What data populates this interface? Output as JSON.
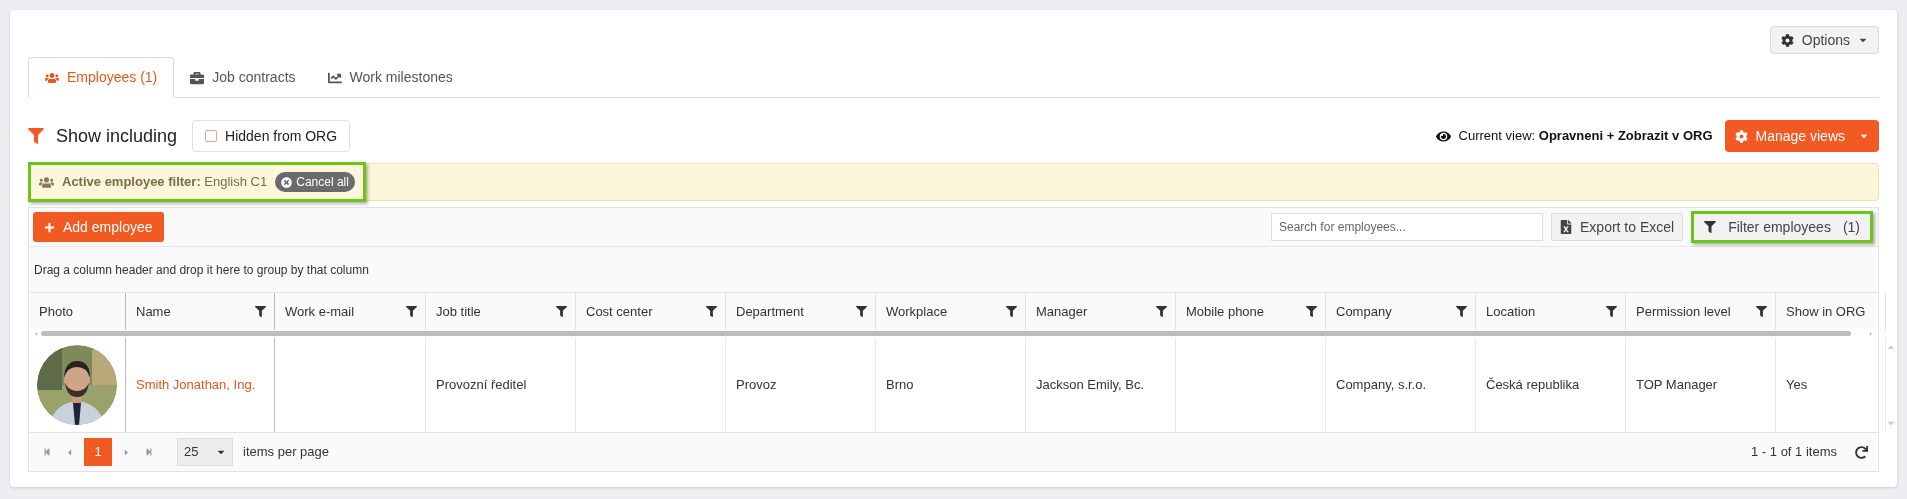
{
  "options_button": {
    "label": "Options"
  },
  "tabs": [
    {
      "label": "Employees (1)",
      "selected": true
    },
    {
      "label": "Job contracts",
      "selected": false
    },
    {
      "label": "Work milestones",
      "selected": false
    }
  ],
  "show_including": {
    "label": "Show including",
    "checkbox": {
      "label": "Hidden from ORG",
      "checked": false
    }
  },
  "current_view": {
    "label": "Current view:",
    "value": "Opravneni + Zobrazit v ORG"
  },
  "manage_views_button": {
    "label": "Manage views"
  },
  "active_filter": {
    "label": "Active employee filter:",
    "value": "English C1",
    "cancel_label": "Cancel all",
    "highlighted": true
  },
  "toolbar": {
    "add_button": "Add employee",
    "search": {
      "placeholder": "Search for employees..."
    },
    "export_button": "Export to Excel",
    "filter_button": {
      "label": "Filter employees",
      "count": "(1)",
      "highlighted": true
    }
  },
  "group_hint": "Drag a column header and drop it here to group by that column",
  "table": {
    "columns": [
      {
        "label": "Photo",
        "filterable": false
      },
      {
        "label": "Name",
        "filterable": true
      },
      {
        "label": "Work e-mail",
        "filterable": true
      },
      {
        "label": "Job title",
        "filterable": true
      },
      {
        "label": "Cost center",
        "filterable": true
      },
      {
        "label": "Department",
        "filterable": true
      },
      {
        "label": "Workplace",
        "filterable": true
      },
      {
        "label": "Manager",
        "filterable": true
      },
      {
        "label": "Mobile phone",
        "filterable": true
      },
      {
        "label": "Company",
        "filterable": true
      },
      {
        "label": "Location",
        "filterable": true
      },
      {
        "label": "Permission level",
        "filterable": true
      },
      {
        "label": "Show in ORG",
        "filterable": false
      }
    ],
    "rows": [
      {
        "cells": [
          {
            "kind": "picture"
          },
          "Smith Jonathan, Ing.",
          "",
          "Provozní ředitel",
          "",
          "Provoz",
          "Brno",
          "Jackson Emily, Bc.",
          "",
          "Company, s.r.o.",
          "Česká republika",
          "TOP Manager",
          "Yes"
        ]
      }
    ]
  },
  "pager": {
    "pages": [
      {
        "label": "1",
        "selected": true
      }
    ],
    "page_size": "25",
    "page_size_label": "items per page",
    "summary": "1 - 1 of 1 items"
  }
}
